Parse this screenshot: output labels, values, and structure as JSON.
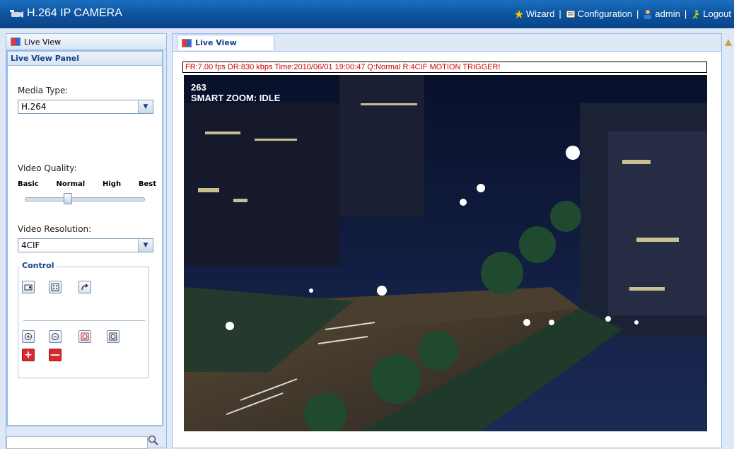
{
  "header": {
    "app_title": "H.264 IP CAMERA",
    "nav": {
      "wizard": "Wizard",
      "configuration": "Configuration",
      "user": "admin",
      "logout": "Logout"
    }
  },
  "left": {
    "tab_label": "Live View",
    "panel_title": "Live View Panel",
    "media_type_label": "Media Type:",
    "media_type_value": "H.264",
    "video_quality_label": "Video Quality:",
    "quality_levels": [
      "Basic",
      "Normal",
      "High",
      "Best"
    ],
    "quality_selected": "Normal",
    "video_resolution_label": "Video Resolution:",
    "video_resolution_value": "4CIF",
    "control_legend": "Control"
  },
  "main": {
    "tab_label": "Live View",
    "status_text": "FR:7.00 fps  DR:830 kbps Time:2010/06/01 19:00:47 Q:Normal R:4CIF  MOTION TRIGGER!",
    "osd_line1": "263",
    "osd_line2": "SMART ZOOM: IDLE"
  },
  "colors": {
    "header_bg": "#0b4f9a",
    "panel_border": "#99bbe8",
    "status_text": "#cc0000",
    "accent_red": "#d8282d"
  }
}
